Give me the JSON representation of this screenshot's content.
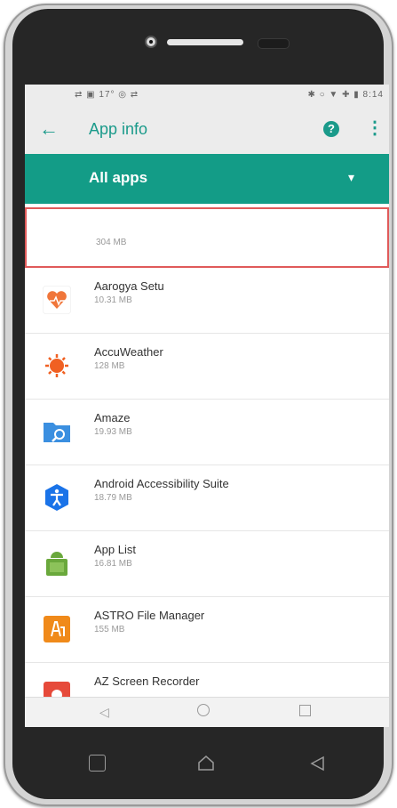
{
  "status_bar": {
    "left_icons": "⇄ ▣ 17° ◎ ⇄",
    "right_icons": "✱ ○ ▼ ✚ ▮ 8:14"
  },
  "toolbar": {
    "back_icon": "arrow-left-icon",
    "title": "App info",
    "help_icon": "help-circle-icon",
    "more_icon": "more-vert-icon"
  },
  "filter": {
    "label": "All apps",
    "dropdown_icon": "chevron-down-icon"
  },
  "apps": [
    {
      "name": "",
      "size": "304 MB",
      "highlighted": true
    },
    {
      "name": "Aarogya Setu",
      "size": "10.31 MB",
      "icon": "aarogya-setu-icon",
      "color": "#f0763a"
    },
    {
      "name": "AccuWeather",
      "size": "128 MB",
      "icon": "accuweather-icon",
      "color": "#f06022"
    },
    {
      "name": "Amaze",
      "size": "19.93 MB",
      "icon": "amaze-folder-icon",
      "color": "#3b8fe0"
    },
    {
      "name": "Android Accessibility Suite",
      "size": "18.79 MB",
      "icon": "accessibility-icon",
      "color": "#1a73e8"
    },
    {
      "name": "App List",
      "size": "16.81 MB",
      "icon": "app-list-icon",
      "color": "#6aa83c"
    },
    {
      "name": "ASTRO File Manager",
      "size": "155 MB",
      "icon": "astro-file-manager-icon",
      "color": "#f08a1a"
    },
    {
      "name": "AZ Screen Recorder",
      "size": "",
      "icon": "az-screen-recorder-icon",
      "color": "#e64a3a"
    }
  ],
  "colors": {
    "accent": "#139c87",
    "highlight_border": "#e05a5a"
  }
}
